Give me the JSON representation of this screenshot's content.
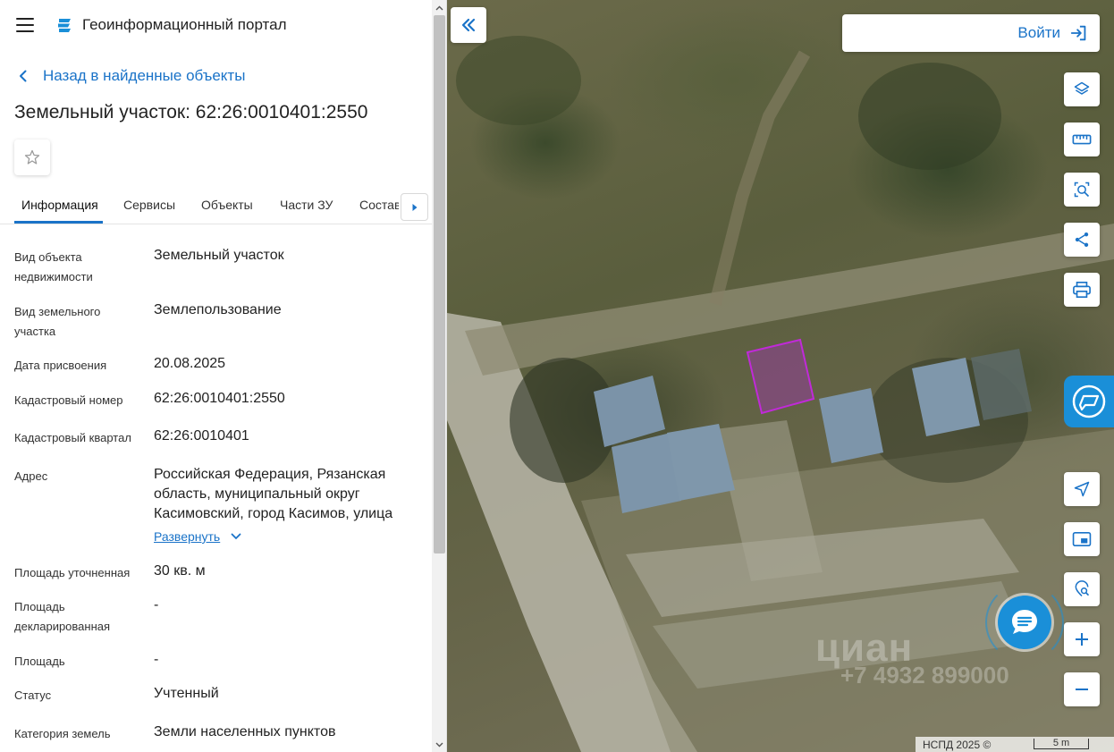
{
  "header": {
    "app_title": "Геоинформационный портал"
  },
  "nav": {
    "back_label": "Назад в найденные объекты"
  },
  "object": {
    "title": "Земельный участок: 62:26:0010401:2550"
  },
  "tabs": [
    {
      "label": "Информация"
    },
    {
      "label": "Сервисы"
    },
    {
      "label": "Объекты"
    },
    {
      "label": "Части ЗУ"
    },
    {
      "label": "Состав"
    }
  ],
  "properties": [
    {
      "label": "Вид объекта недвижимости",
      "value": "Земельный участок"
    },
    {
      "label": "Вид земельного участка",
      "value": "Землепользование"
    },
    {
      "label": "Дата присвоения",
      "value": "20.08.2025"
    },
    {
      "label": "Кадастровый номер",
      "value": "62:26:0010401:2550"
    },
    {
      "label": "Кадастровый квартал",
      "value": "62:26:0010401"
    },
    {
      "label": "Адрес",
      "value": "Российская Федерация, Рязанская область, муниципальный округ Касимовский, город Касимов, улица"
    },
    {
      "label": "Площадь уточненная",
      "value": "30 кв. м"
    },
    {
      "label": "Площадь декларированная",
      "value": "-"
    },
    {
      "label": "Площадь",
      "value": "-"
    },
    {
      "label": "Статус",
      "value": "Учтенный"
    },
    {
      "label": "Категория земель",
      "value": "Земли населенных пунктов"
    }
  ],
  "address_expand_label": "Развернуть",
  "map": {
    "login_label": "Войти",
    "watermark": "циан",
    "watermark_phone": "+7 4932 899000",
    "attribution": "НСПД 2025 ©",
    "scale_label": "5 m",
    "tools": [
      "layers-icon",
      "ruler-icon",
      "area-search-icon",
      "share-icon",
      "print-icon",
      "locate-icon",
      "minimap-icon",
      "search-location-icon",
      "zoom-in-icon",
      "zoom-out-icon"
    ]
  },
  "colors": {
    "accent": "#1a73c8",
    "widget": "#1a8fd8",
    "parcel": "#b02cc8"
  }
}
